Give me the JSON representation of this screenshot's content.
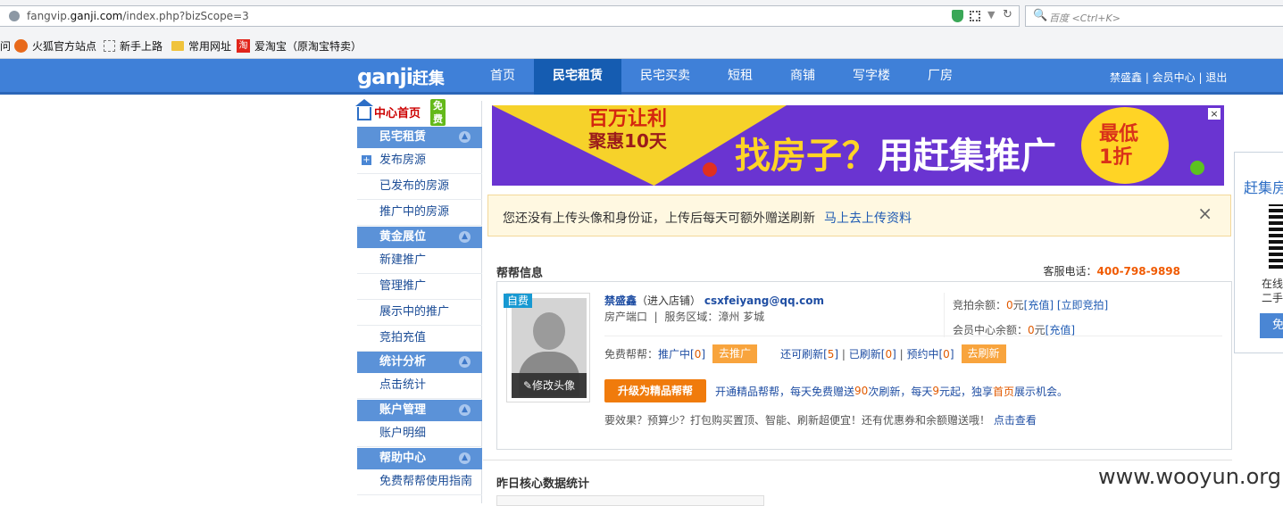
{
  "browser": {
    "url_prefix": "fangvip.",
    "url_domain": "ganji.com",
    "url_path": "/index.php?bizScope=3",
    "search_placeholder": "百度 <Ctrl+K>",
    "bookmarks": [
      "问",
      "火狐官方站点",
      "新手上路",
      "常用网址",
      "爱淘宝（原淘宝特卖）"
    ]
  },
  "header": {
    "logo": "ganji",
    "logo_zh": "赶集",
    "nav": [
      "首页",
      "民宅租赁",
      "民宅买卖",
      "短租",
      "商铺",
      "写字楼",
      "厂房"
    ],
    "active_nav": "民宅租赁",
    "user_links": "禁盛鑫 | 会员中心 | 退出"
  },
  "sidebar": {
    "home": "中心首页",
    "free_badge": "免费",
    "sections": [
      {
        "title": "民宅租赁",
        "items": [
          "发布房源",
          "已发布的房源",
          "推广中的房源"
        ]
      },
      {
        "title": "黄金展位",
        "items": [
          "新建推广",
          "管理推广",
          "展示中的推广",
          "竞拍充值"
        ]
      },
      {
        "title": "统计分析",
        "items": [
          "点击统计"
        ]
      },
      {
        "title": "账户管理",
        "items": [
          "账户明细"
        ]
      },
      {
        "title": "帮助中心",
        "items": [
          "免费帮帮使用指南"
        ]
      }
    ]
  },
  "banner": {
    "promo_line1": "百万让利",
    "promo_line2": "聚惠10天",
    "slogan_part1": "找房子？",
    "slogan_part2": "用赶集推广",
    "circle_line1": "最低",
    "circle_line2": "1折",
    "close": "×"
  },
  "notice": {
    "text": "您还没有上传头像和身份证，上传后每天可额外赠送刷新",
    "link": "马上去上传资料",
    "close": "×"
  },
  "help": {
    "title": "帮帮信息",
    "phone_label": "客服电话：",
    "phone": "400-798-9898"
  },
  "profile": {
    "self_badge": "自费",
    "edit_avatar": "修改头像",
    "name": "禁盛鑫",
    "shop_link": "（进入店铺）",
    "email": "csxfeiyang@qq.com",
    "port": "房产端口",
    "service_area": "服务区域：漳州 芗城",
    "bid_balance_label": "竞拍余额：",
    "bid_balance": "0",
    "yuan": "元",
    "recharge": "[充值]",
    "bid_now": "[立即竞拍]",
    "member_balance_label": "会员中心余额：",
    "member_balance": "0"
  },
  "bang": {
    "free_label": "免费帮帮：",
    "promoting_label": "推广中",
    "promoting": "0",
    "go_promote": "去推广",
    "can_refresh_label": "还可刷新",
    "can_refresh": "5",
    "refreshed_label": "已刷新",
    "refreshed": "0",
    "scheduled_label": "预约中",
    "scheduled": "0",
    "go_refresh": "去刷新"
  },
  "upgrade": {
    "button": "升级为精品帮帮",
    "text_a": "开通精品帮帮，每天免费赠送",
    "count": "90",
    "text_b": "次刷新，每天",
    "price": "9",
    "text_c": "元起，独享",
    "home": "首页",
    "text_d": "展示机会。"
  },
  "effect": {
    "text": "要效果？预算少？打包购买置顶、智能、刷新超便宜！还有优惠券和余额赠送哦！",
    "link": "点击查看"
  },
  "stats": {
    "title": "昨日核心数据统计"
  },
  "side_card": {
    "title": "赶集房",
    "line1": "在线",
    "line2": "二手",
    "button": "免"
  },
  "watermark": "www.wooyun.org"
}
